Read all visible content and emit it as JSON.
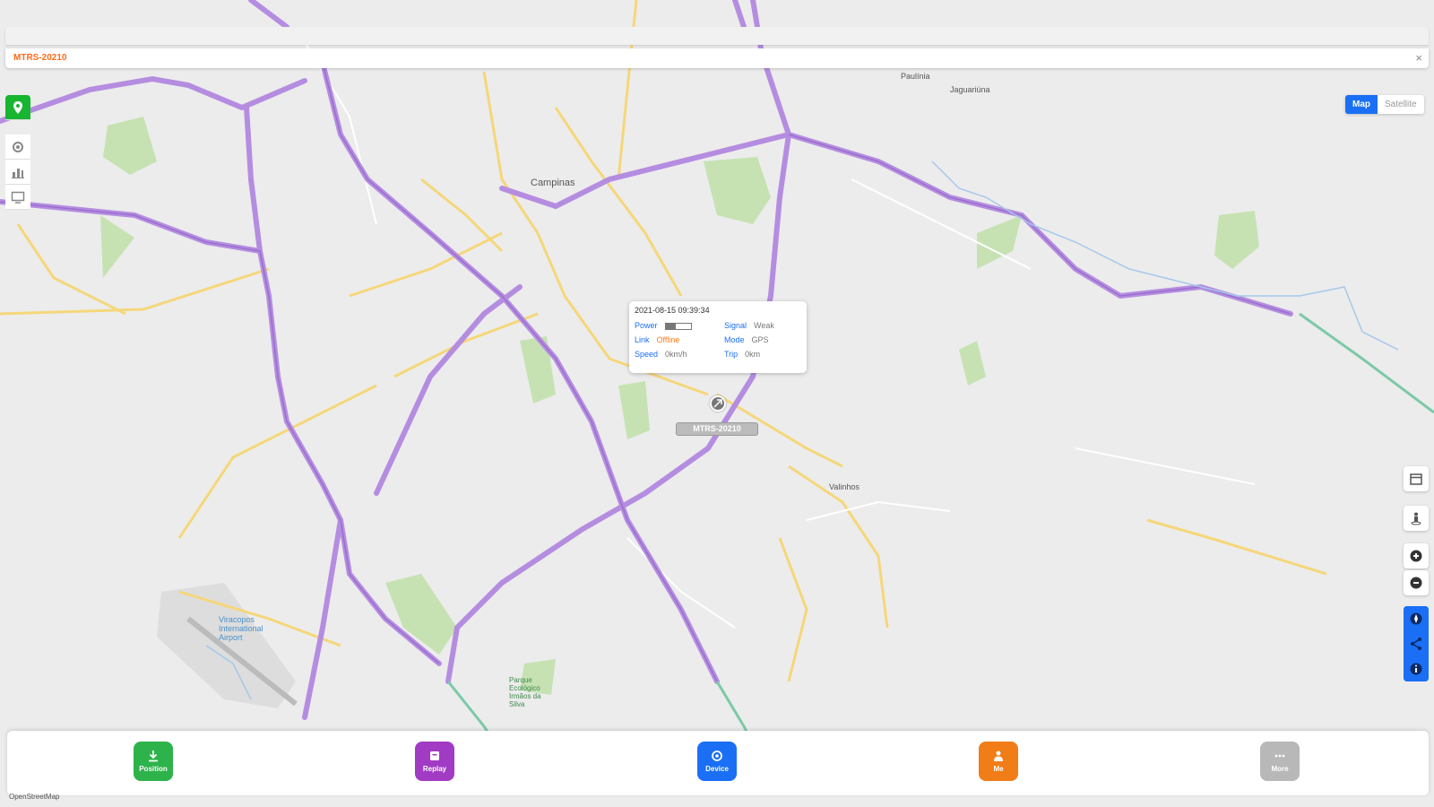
{
  "app": {
    "device_id": "MTRS-20210",
    "close_symbol": "×"
  },
  "map_type": {
    "map_label": "Map",
    "satellite_label": "Satellite",
    "active": "Map"
  },
  "left_toolbar": [
    {
      "name": "location-pin-icon",
      "active": true
    },
    {
      "name": "settings-icon",
      "active": false
    },
    {
      "name": "chart-icon",
      "active": false
    },
    {
      "name": "monitor-icon",
      "active": false
    }
  ],
  "popup": {
    "datetime": "2021-08-15 09:39:34",
    "power_label": "Power",
    "power_level": 0.4,
    "signal_label": "Signal",
    "signal_value": "Weak",
    "link_label": "Link",
    "link_value": "Offline",
    "mode_label": "Mode",
    "mode_value": "GPS",
    "speed_label": "Speed",
    "speed_value": "0km/h",
    "trip_label": "Trip",
    "trip_value": "0km"
  },
  "marker": {
    "label": "MTRS-20210"
  },
  "map_labels": {
    "city_main": "Campinas",
    "city_valinhos": "Valinhos",
    "city_paulinia": "Paulínia",
    "city_jaguariuna": "Jaguariúna",
    "airport": "Viracopos International Airport",
    "park": "Parque Ecológico Irmãos da Silva"
  },
  "right_tools": [
    {
      "name": "calendar-icon"
    },
    {
      "name": "street-view-icon"
    },
    {
      "name": "zoom-in-icon"
    },
    {
      "name": "zoom-out-icon"
    }
  ],
  "right_tools_blue": [
    {
      "name": "compass-icon"
    },
    {
      "name": "share-icon"
    },
    {
      "name": "info-icon"
    }
  ],
  "bottom_nav": [
    {
      "label": "Position",
      "color": "#2db34a",
      "icon": "download-icon"
    },
    {
      "label": "Replay",
      "color": "#a23bc4",
      "icon": "replay-icon"
    },
    {
      "label": "Device",
      "color": "#1a6ff5",
      "icon": "device-icon"
    },
    {
      "label": "Me",
      "color": "#f07d17",
      "icon": "person-icon"
    },
    {
      "label": "More",
      "color": "#b8b8b8",
      "icon": "more-icon"
    }
  ],
  "attribution": "OpenStreetMap"
}
